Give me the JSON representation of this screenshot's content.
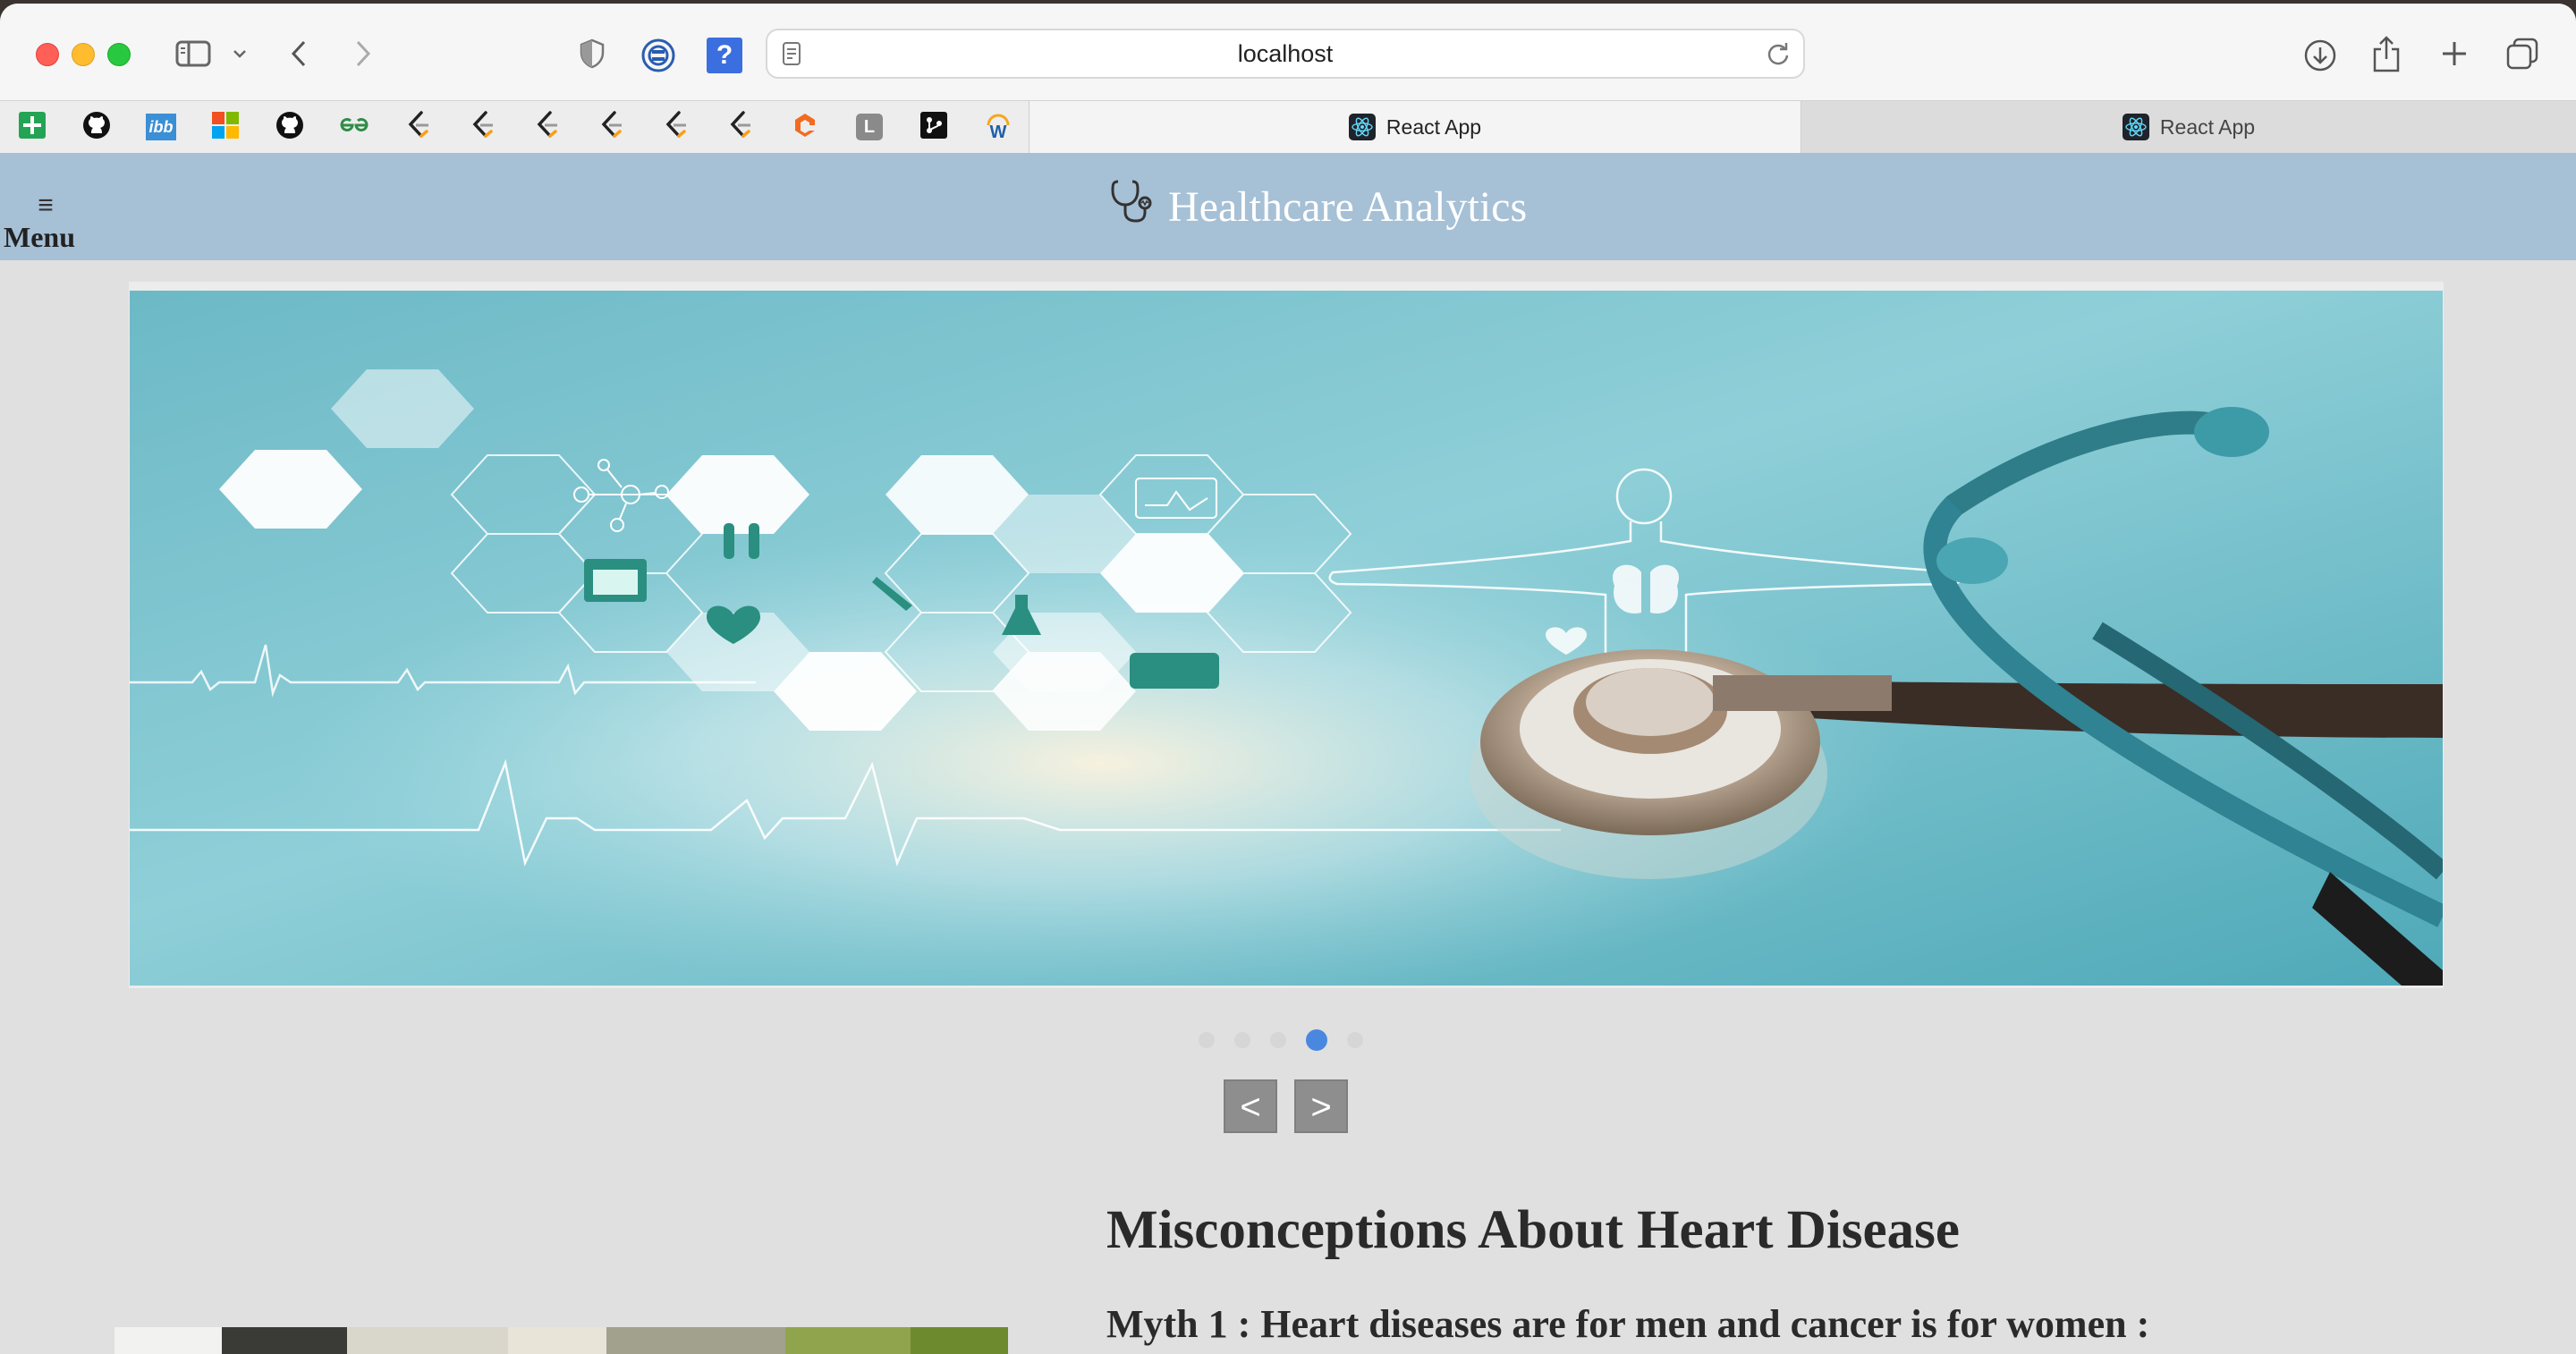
{
  "browser": {
    "url": "localhost",
    "tabs": [
      {
        "label": "React App",
        "active": true
      },
      {
        "label": "React App",
        "active": false
      }
    ],
    "favorites": [
      {
        "icon": "add-sheet-icon"
      },
      {
        "icon": "github-icon"
      },
      {
        "icon": "ibb-icon"
      },
      {
        "icon": "microsoft-icon"
      },
      {
        "icon": "github-icon"
      },
      {
        "icon": "geeksforgeeks-icon"
      },
      {
        "icon": "leetcode-icon"
      },
      {
        "icon": "leetcode-icon"
      },
      {
        "icon": "leetcode-icon"
      },
      {
        "icon": "leetcode-icon"
      },
      {
        "icon": "leetcode-icon"
      },
      {
        "icon": "leetcode-icon"
      },
      {
        "icon": "orange-logo-icon"
      },
      {
        "icon": "l-letter-icon"
      },
      {
        "icon": "git-icon"
      },
      {
        "icon": "w-logo-icon"
      }
    ],
    "favorite_labels": {
      "ibb": "ibb",
      "l": "L",
      "w": "W"
    }
  },
  "header": {
    "menu_label": "Menu",
    "menu_icon": "≡",
    "title": "Healthcare Analytics",
    "logo_icon": "stethoscope-icon"
  },
  "carousel": {
    "slide_count": 5,
    "active_index": 3,
    "prev_label": "<",
    "next_label": ">",
    "slide_image": "medical-stethoscope-hexagon-banner"
  },
  "article": {
    "title": "Misconceptions About Heart Disease",
    "subtitle": "Myth 1 : Heart diseases are for men and cancer is for women :"
  },
  "colors": {
    "header_bg": "#a6c0d6",
    "page_bg": "#e0e0e0",
    "dot_active": "#4a88e0",
    "dot_inactive": "#d6d6d6",
    "nav_button": "#8e8e8e"
  }
}
